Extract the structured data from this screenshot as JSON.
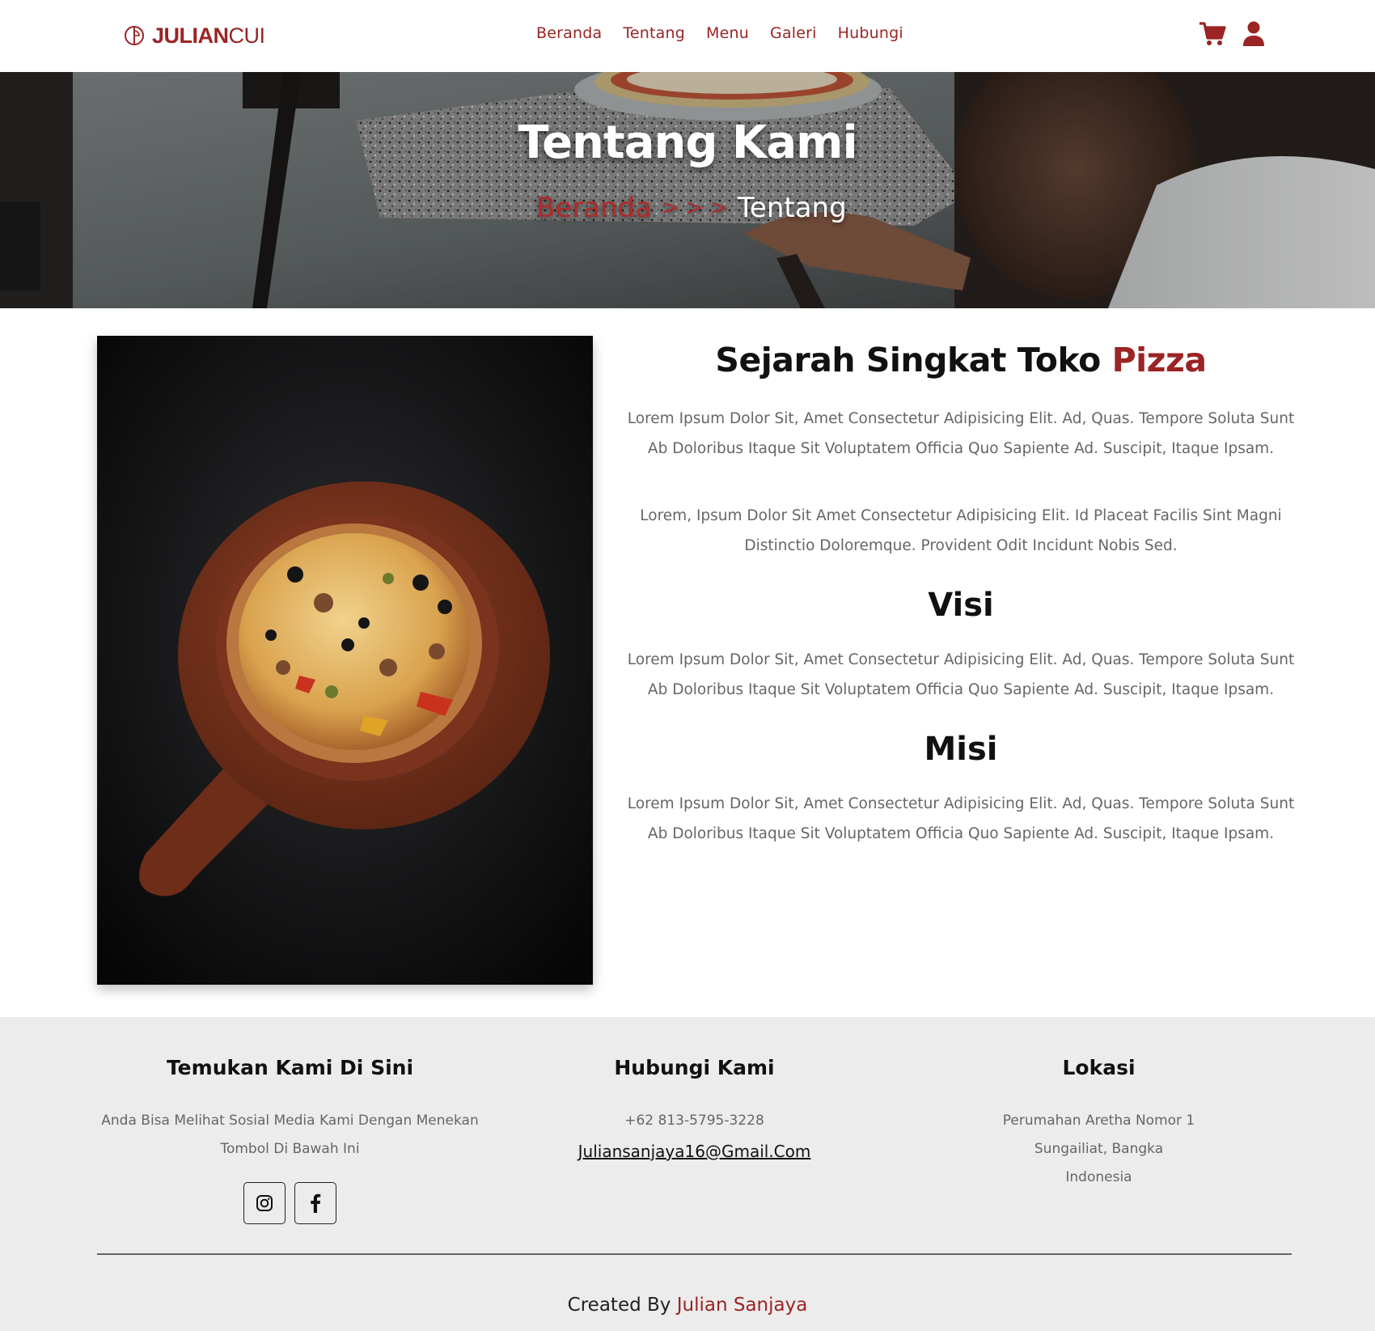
{
  "brand": {
    "name_bold": "JULIAN",
    "name_light": "CUI"
  },
  "nav": {
    "links": [
      {
        "label": "Beranda"
      },
      {
        "label": "Tentang"
      },
      {
        "label": "Menu"
      },
      {
        "label": "Galeri"
      },
      {
        "label": "Hubungi"
      }
    ],
    "icons": [
      "shopping-cart-icon",
      "user-icon"
    ]
  },
  "hero": {
    "title": "Tentang Kami",
    "breadcrumb": {
      "home": "Beranda",
      "separator": "> > >",
      "current": "Tentang"
    }
  },
  "about": {
    "title": "Sejarah Singkat Toko",
    "title_accent": "Pizza",
    "paragraph_1": "Lorem Ipsum Dolor Sit, Amet Consectetur Adipisicing Elit. Ad, Quas. Tempore Soluta Sunt Ab Doloribus Itaque Sit Voluptatem Officia Quo Sapiente Ad. Suscipit, Itaque Ipsam.",
    "paragraph_2": "Lorem, Ipsum Dolor Sit Amet Consectetur Adipisicing Elit. Id Placeat Facilis Sint Magni Distinctio Doloremque. Provident Odit Incidunt Nobis Sed.",
    "visi_title": "Visi",
    "visi_text": "Lorem Ipsum Dolor Sit, Amet Consectetur Adipisicing Elit. Ad, Quas. Tempore Soluta Sunt Ab Doloribus Itaque Sit Voluptatem Officia Quo Sapiente Ad. Suscipit, Itaque Ipsam.",
    "misi_title": "Misi",
    "misi_text": "Lorem Ipsum Dolor Sit, Amet Consectetur Adipisicing Elit. Ad, Quas. Tempore Soluta Sunt Ab Doloribus Itaque Sit Voluptatem Officia Quo Sapiente Ad. Suscipit, Itaque Ipsam."
  },
  "footer": {
    "social": {
      "title": "Temukan Kami Di Sini",
      "desc_line1": "Anda Bisa Melihat Sosial Media Kami Dengan Menekan",
      "desc_line2": "Tombol Di Bawah Ini",
      "buttons": [
        "instagram-icon",
        "facebook-icon"
      ]
    },
    "contact": {
      "title": "Hubungi Kami",
      "phone": "+62 813-5795-3228",
      "email": "Juliansanjaya16@Gmail.Com"
    },
    "location": {
      "title": "Lokasi",
      "line1": "Perumahan Aretha Nomor 1",
      "line2": "Sungailiat, Bangka",
      "line3": "Indonesia"
    },
    "credits": {
      "prefix": "Created By",
      "author": "Julian Sanjaya"
    }
  },
  "colors": {
    "accent": "#9b2424",
    "footer_bg": "#ececec",
    "text_muted": "#666666"
  }
}
